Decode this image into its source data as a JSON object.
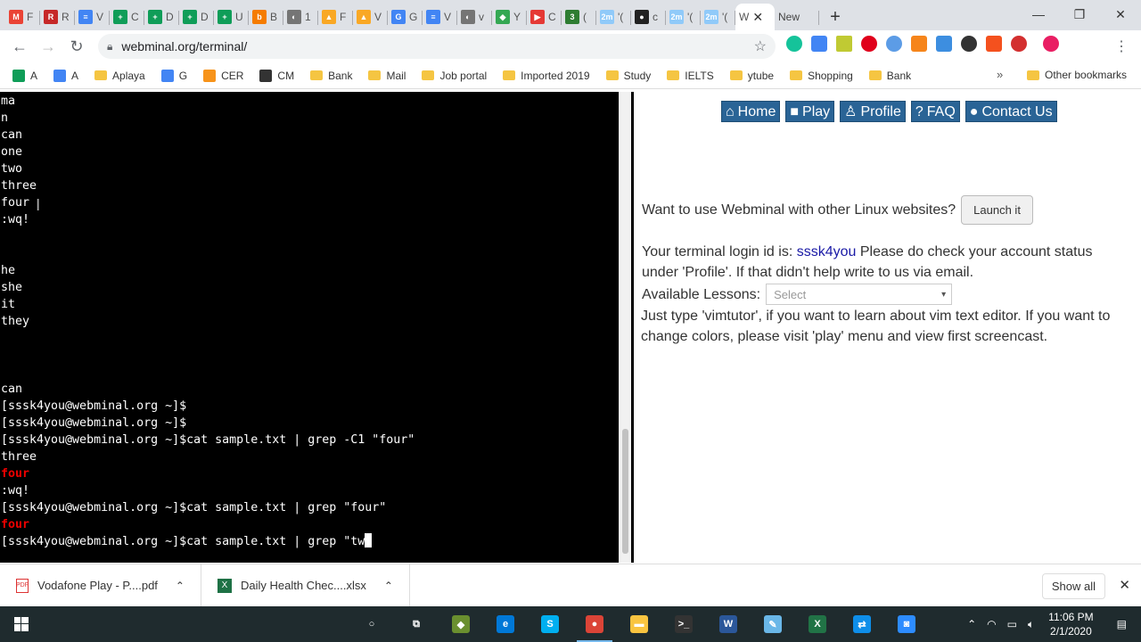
{
  "browser": {
    "tabs": [
      {
        "letter": "M",
        "label": "F",
        "color": "#ea4335"
      },
      {
        "letter": "R",
        "label": "R",
        "color": "#c62828"
      },
      {
        "letter": "≡",
        "label": "V",
        "color": "#4285f4"
      },
      {
        "letter": "+",
        "label": "C",
        "color": "#0f9d58"
      },
      {
        "letter": "+",
        "label": "D",
        "color": "#0f9d58"
      },
      {
        "letter": "+",
        "label": "D",
        "color": "#0f9d58"
      },
      {
        "letter": "+",
        "label": "U",
        "color": "#0f9d58"
      },
      {
        "letter": "b",
        "label": "B",
        "color": "#f57c00"
      },
      {
        "letter": "◐",
        "label": "1",
        "color": "#757575"
      },
      {
        "letter": "▲",
        "label": "F",
        "color": "#f9a825"
      },
      {
        "letter": "▲",
        "label": "V",
        "color": "#f9a825"
      },
      {
        "letter": "G",
        "label": "G",
        "color": "#4285f4"
      },
      {
        "letter": "≡",
        "label": "V",
        "color": "#4285f4"
      },
      {
        "letter": "◐",
        "label": "v",
        "color": "#757575"
      },
      {
        "letter": "◆",
        "label": "Y",
        "color": "#34a853"
      },
      {
        "letter": "▶",
        "label": "C",
        "color": "#e53935"
      },
      {
        "letter": "3",
        "label": "(",
        "color": "#2e7d32"
      },
      {
        "letter": "2m",
        "label": "'(",
        "color": "#90caf9"
      },
      {
        "letter": "●",
        "label": "c",
        "color": "#222222"
      },
      {
        "letter": "2m",
        "label": "'(",
        "color": "#90caf9"
      },
      {
        "letter": "2m",
        "label": "'(",
        "color": "#90caf9"
      }
    ],
    "active_tab": {
      "label": "W",
      "close": "✕"
    },
    "new_tab_label": "New",
    "new_tab_plus": "+",
    "window_controls": {
      "minimize": "—",
      "maximize": "❐",
      "close": "✕"
    },
    "url": "webminal.org/terminal/",
    "bookmarks": [
      {
        "label": "A",
        "type": "sheet",
        "color": "#0f9d58"
      },
      {
        "label": "A",
        "type": "doc",
        "color": "#4285f4"
      },
      {
        "label": "Aplaya",
        "type": "folder"
      },
      {
        "label": "G",
        "type": "google",
        "color": "#4285f4"
      },
      {
        "label": "CER",
        "type": "bitcoin",
        "color": "#f7931a"
      },
      {
        "label": "CM",
        "type": "cm",
        "color": "#333333"
      },
      {
        "label": "Bank",
        "type": "folder"
      },
      {
        "label": "Mail",
        "type": "folder"
      },
      {
        "label": "Job portal",
        "type": "folder"
      },
      {
        "label": "Imported 2019",
        "type": "folder"
      },
      {
        "label": "Study",
        "type": "folder"
      },
      {
        "label": "IELTS",
        "type": "folder"
      },
      {
        "label": "ytube",
        "type": "folder"
      },
      {
        "label": "Shopping",
        "type": "folder"
      },
      {
        "label": "Bank",
        "type": "folder"
      }
    ],
    "bookmarks_more": "»",
    "other_bookmarks": "Other bookmarks"
  },
  "terminal": {
    "lines": [
      {
        "text": "ma"
      },
      {
        "text": "n"
      },
      {
        "text": "can"
      },
      {
        "text": "one"
      },
      {
        "text": "two"
      },
      {
        "text": "three"
      },
      {
        "text": "four"
      },
      {
        "text": ":wq!"
      },
      {
        "text": ""
      },
      {
        "text": ""
      },
      {
        "text": "he"
      },
      {
        "text": "she"
      },
      {
        "text": "it"
      },
      {
        "text": "they"
      },
      {
        "text": ""
      },
      {
        "text": ""
      },
      {
        "text": ""
      },
      {
        "text": "can"
      },
      {
        "text": "[sssk4you@webminal.org ~]$"
      },
      {
        "text": "[sssk4you@webminal.org ~]$"
      },
      {
        "text": "[sssk4you@webminal.org ~]$cat sample.txt | grep -C1 \"four\""
      },
      {
        "text": "three"
      },
      {
        "text": "four",
        "highlight": true
      },
      {
        "text": ":wq!"
      },
      {
        "text": "[sssk4you@webminal.org ~]$cat sample.txt | grep \"four\""
      },
      {
        "text": "four",
        "highlight": true
      }
    ],
    "current_input": "[sssk4you@webminal.org ~]$cat sample.txt | grep \"tw",
    "cursor_char": "\""
  },
  "site": {
    "nav": [
      {
        "icon": "⌂",
        "label": "Home"
      },
      {
        "icon": "■",
        "label": "Play"
      },
      {
        "icon": "♙",
        "label": "Profile"
      },
      {
        "icon": "?",
        "label": "FAQ"
      },
      {
        "icon": "●",
        "label": "Contact Us"
      }
    ],
    "launch_text": "Want to use Webminal with other Linux websites?",
    "launch_button": "Launch it",
    "login_prefix": "Your terminal login id is: ",
    "login_id": "sssk4you",
    "login_suffix": " Please do check your account status under 'Profile'. If that didn't help write to us via email.",
    "lessons_label": "Available Lessons:",
    "lessons_select": "Select",
    "vim_text": "Just type 'vimtutor', if you want to learn about vim text editor. If you want to change colors, please visit 'play' menu and view first screencast."
  },
  "downloads": {
    "items": [
      {
        "name": "Vodafone Play - P....pdf",
        "type": "pdf"
      },
      {
        "name": "Daily Health Chec....xlsx",
        "type": "xlsx"
      }
    ],
    "show_all": "Show all",
    "close": "✕"
  },
  "taskbar": {
    "time": "11:06 PM",
    "date": "2/1/2020",
    "apps": [
      {
        "name": "cortana-icon",
        "glyph": "○",
        "color": "transparent"
      },
      {
        "name": "task-view-icon",
        "glyph": "⧉",
        "color": "transparent"
      },
      {
        "name": "store-icon",
        "glyph": "◆",
        "color": "#6a8f2f"
      },
      {
        "name": "edge-icon",
        "glyph": "e",
        "color": "#0078d7"
      },
      {
        "name": "skype-icon",
        "glyph": "S",
        "color": "#00aff0"
      },
      {
        "name": "chrome-icon",
        "glyph": "●",
        "color": "#db4437",
        "active": true
      },
      {
        "name": "file-explorer-icon",
        "glyph": "▬",
        "color": "#f9c440"
      },
      {
        "name": "terminal-icon",
        "glyph": ">_",
        "color": "#333333"
      },
      {
        "name": "word-icon",
        "glyph": "W",
        "color": "#2b579a"
      },
      {
        "name": "notepad-icon",
        "glyph": "✎",
        "color": "#6ab7e8"
      },
      {
        "name": "excel-icon",
        "glyph": "X",
        "color": "#217346"
      },
      {
        "name": "teamviewer-icon",
        "glyph": "⇄",
        "color": "#0e8ee9"
      },
      {
        "name": "zoom-icon",
        "glyph": "◙",
        "color": "#2d8cff"
      }
    ]
  }
}
